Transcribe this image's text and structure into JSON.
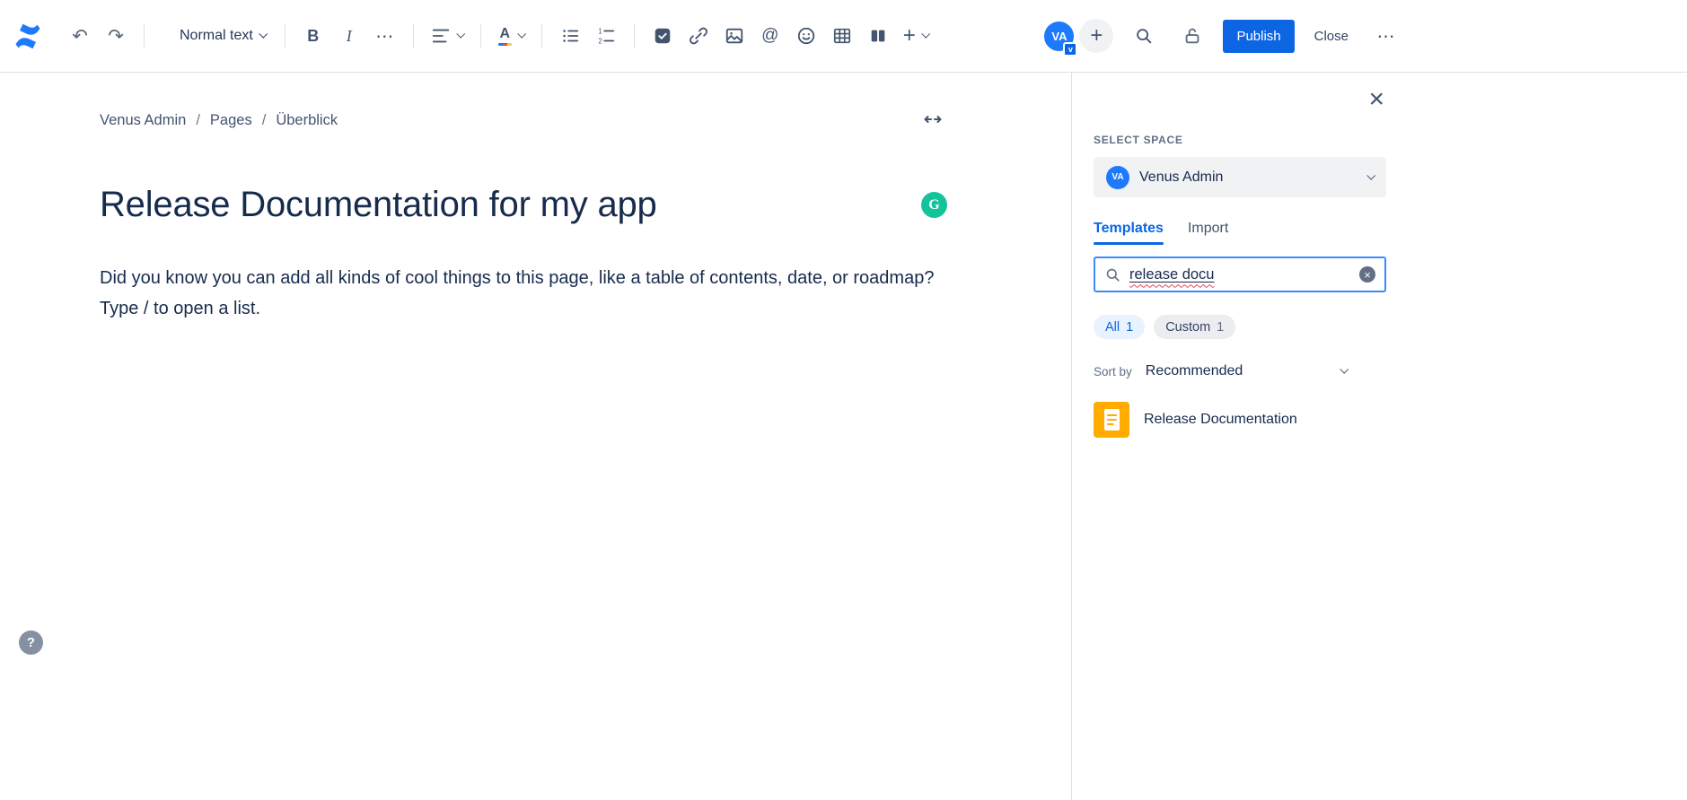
{
  "toolbar": {
    "undo": "↶",
    "redo": "↷",
    "text_style": "Normal text",
    "bold": "B",
    "italic": "I",
    "more": "⋯",
    "mention": "@",
    "insert_plus": "+",
    "avatar_initials": "VA",
    "avatar_badge": "v",
    "publish": "Publish",
    "close": "Close",
    "more_actions": "⋯"
  },
  "breadcrumb": {
    "items": [
      "Venus Admin",
      "Pages",
      "Überblick"
    ],
    "separator": "/"
  },
  "editor": {
    "title": "Release Documentation for my app",
    "grammarly": "G",
    "body_lines": [
      "Did you know you can add all kinds of cool things to this page, like a table of contents, date, or roadmap?",
      "Type / to open a list."
    ],
    "help": "?"
  },
  "panel": {
    "close_icon": "×",
    "select_space_label": "SELECT SPACE",
    "space": {
      "initials": "VA",
      "name": "Venus Admin"
    },
    "tabs": [
      {
        "label": "Templates",
        "active": true
      },
      {
        "label": "Import",
        "active": false
      }
    ],
    "search_value": "release docu",
    "clear_icon": "×",
    "filters": [
      {
        "label": "All",
        "count": "1",
        "active": true
      },
      {
        "label": "Custom",
        "count": "1",
        "active": false
      }
    ],
    "sort_label": "Sort by",
    "sort_value": "Recommended",
    "templates": [
      {
        "name": "Release Documentation"
      }
    ]
  },
  "colors": {
    "accent_blue": "#0C66E4",
    "logo_blue": "#1D7AFC",
    "template_icon_orange": "#FFAB00",
    "grammarly_green": "#15C39A",
    "spellcheck_red": "#E5484D",
    "search_focus_border": "#388BFF"
  }
}
